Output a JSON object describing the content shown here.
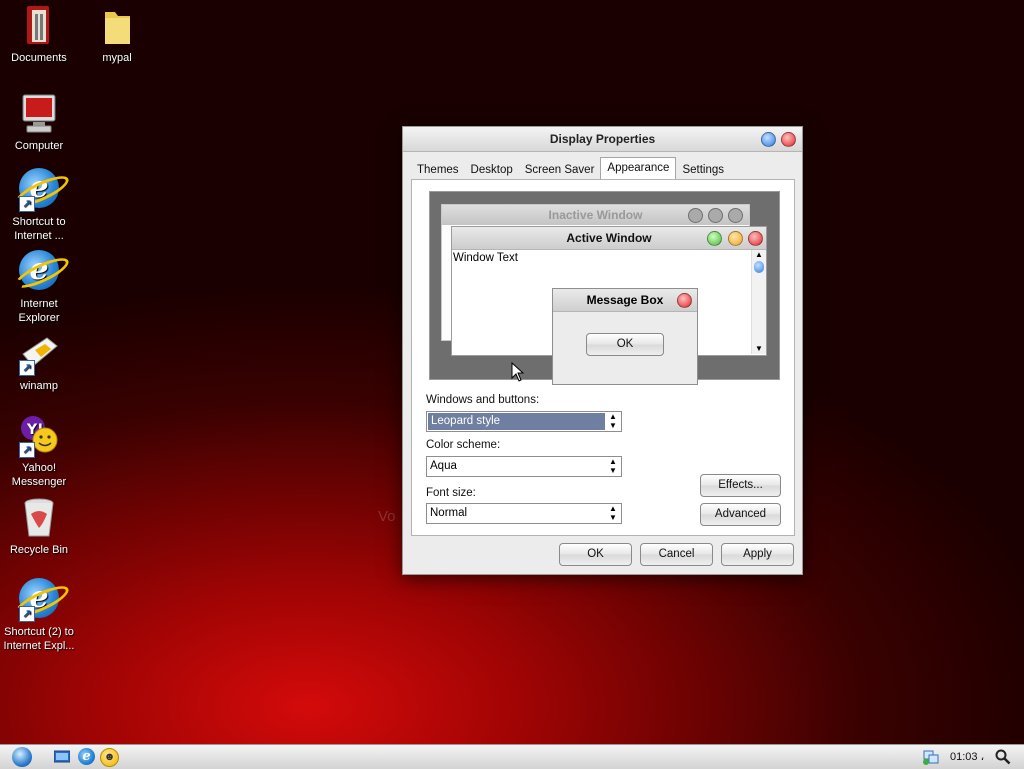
{
  "desktop": {
    "icons": [
      {
        "label": "Documents"
      },
      {
        "label": "mypal"
      },
      {
        "label": "Computer"
      },
      {
        "label": "Shortcut to Internet ..."
      },
      {
        "label": "Internet Explorer"
      },
      {
        "label": "winamp"
      },
      {
        "label": "Yahoo! Messenger"
      },
      {
        "label": "Recycle Bin"
      },
      {
        "label": "Shortcut (2) to Internet Expl..."
      }
    ],
    "ghost_text": "Vo"
  },
  "dialog": {
    "title": "Display Properties",
    "tabs": [
      {
        "label": "Themes"
      },
      {
        "label": "Desktop"
      },
      {
        "label": "Screen Saver"
      },
      {
        "label": "Appearance",
        "active": true
      },
      {
        "label": "Settings"
      }
    ],
    "preview": {
      "inactive_title": "Inactive Window",
      "active_title": "Active Window",
      "window_text": "Window Text",
      "message_box_title": "Message Box",
      "message_box_ok": "OK"
    },
    "windows_and_buttons": {
      "label": "Windows and buttons:",
      "value": "Leopard style"
    },
    "color_scheme": {
      "label": "Color scheme:",
      "value": "Aqua"
    },
    "font_size": {
      "label": "Font size:",
      "value": "Normal"
    },
    "effects_button": "Effects...",
    "advanced_button": "Advanced",
    "ok_button": "OK",
    "cancel_button": "Cancel",
    "apply_button": "Apply"
  },
  "taskbar": {
    "clock": "01:03 ،"
  },
  "colors": {
    "close": "#e0242a",
    "minimize": "#f2a21c",
    "zoom": "#49b83a",
    "help": "#2f7be0",
    "selection": "#6f7fa1"
  }
}
